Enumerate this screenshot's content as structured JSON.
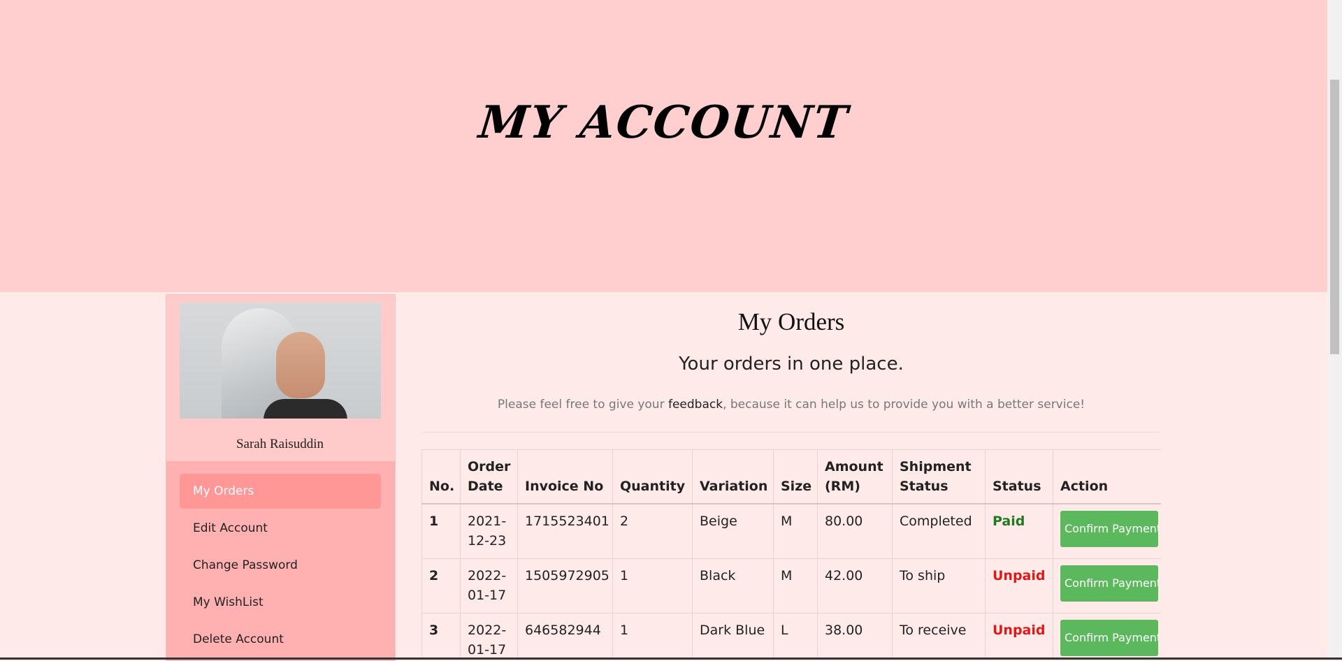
{
  "banner": {
    "title": "MY ACCOUNT"
  },
  "profile": {
    "name": "Sarah Raisuddin"
  },
  "nav": {
    "items": [
      {
        "label": "My Orders",
        "active": true
      },
      {
        "label": "Edit Account",
        "active": false
      },
      {
        "label": "Change Password",
        "active": false
      },
      {
        "label": "My WishList",
        "active": false
      },
      {
        "label": "Delete Account",
        "active": false
      }
    ]
  },
  "main": {
    "title": "My Orders",
    "subtitle": "Your orders in one place.",
    "note_before": "Please feel free to give your ",
    "note_link": "feedback",
    "note_after": ", because it can help us to provide you with a better service!"
  },
  "orders": {
    "headers": [
      "No.",
      "Order Date",
      "Invoice No",
      "Quantity",
      "Variation",
      "Size",
      "Amount (RM)",
      "Shipment Status",
      "Status",
      "Action"
    ],
    "rows": [
      {
        "no": "1",
        "date": "2021-12-23",
        "invoice": "1715523401",
        "qty": "2",
        "variation": "Beige",
        "size": "M",
        "amount": "80.00",
        "shipment": "Completed",
        "status": "Paid",
        "action": "Confirm Payment"
      },
      {
        "no": "2",
        "date": "2022-01-17",
        "invoice": "1505972905",
        "qty": "1",
        "variation": "Black",
        "size": "M",
        "amount": "42.00",
        "shipment": "To ship",
        "status": "Unpaid",
        "action": "Confirm Payment"
      },
      {
        "no": "3",
        "date": "2022-01-17",
        "invoice": "646582944",
        "qty": "1",
        "variation": "Dark Blue",
        "size": "L",
        "amount": "38.00",
        "shipment": "To receive",
        "status": "Unpaid",
        "action": "Confirm Payment"
      }
    ]
  },
  "colors": {
    "banner_bg": "#ffcece",
    "page_bg": "#ffeaea",
    "nav_active": "#ff9797",
    "paid": "#1f7a1f",
    "unpaid": "#e01818",
    "confirm_button": "#5cb85c"
  }
}
